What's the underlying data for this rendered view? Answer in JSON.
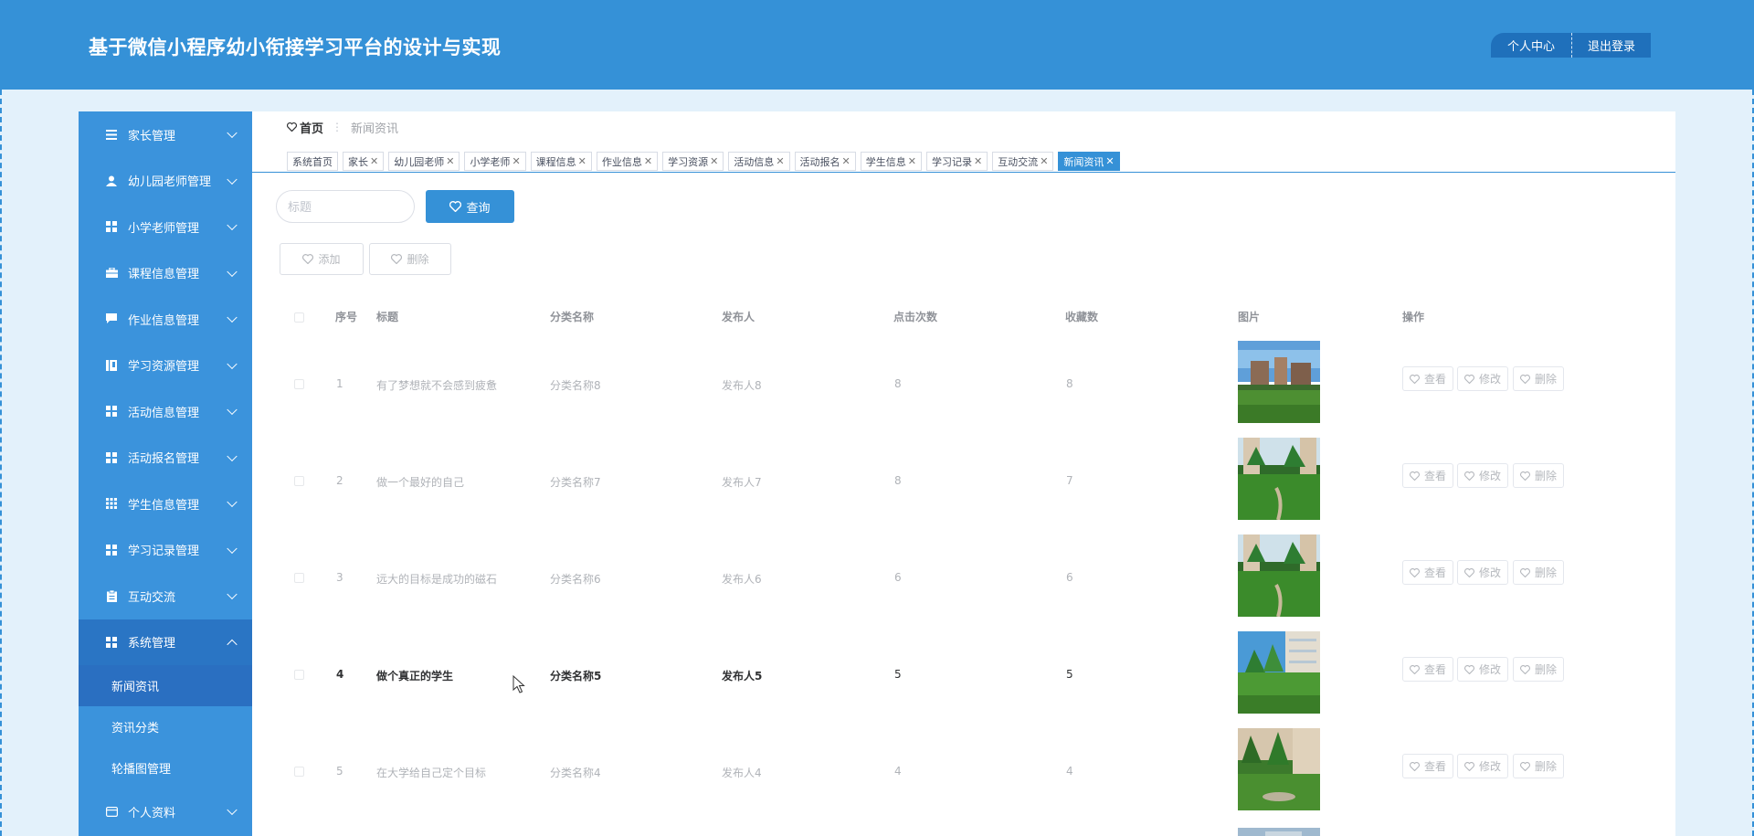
{
  "header": {
    "title": "基于微信小程序幼小衔接学习平台的设计与实现",
    "personal_center": "个人中心",
    "logout": "退出登录"
  },
  "sidebar": {
    "items": [
      {
        "label": "家长管理",
        "icon": "list-icon"
      },
      {
        "label": "幼儿园老师管理",
        "icon": "user-icon"
      },
      {
        "label": "小学老师管理",
        "icon": "grid-icon"
      },
      {
        "label": "课程信息管理",
        "icon": "briefcase-icon"
      },
      {
        "label": "作业信息管理",
        "icon": "chat-icon"
      },
      {
        "label": "学习资源管理",
        "icon": "book-icon"
      },
      {
        "label": "活动信息管理",
        "icon": "grid-icon"
      },
      {
        "label": "活动报名管理",
        "icon": "grid-icon"
      },
      {
        "label": "学生信息管理",
        "icon": "grid-icon"
      },
      {
        "label": "学习记录管理",
        "icon": "grid-icon"
      },
      {
        "label": "互动交流",
        "icon": "clipboard-icon"
      },
      {
        "label": "系统管理",
        "icon": "grid-icon"
      }
    ],
    "system_sub": [
      "新闻资讯",
      "资讯分类",
      "轮播图管理"
    ],
    "profile": "个人资料"
  },
  "breadcrumb": {
    "home": "首页",
    "current": "新闻资讯"
  },
  "tags": [
    "系统首页",
    "家长",
    "幼儿园老师",
    "小学老师",
    "课程信息",
    "作业信息",
    "学习资源",
    "活动信息",
    "活动报名",
    "学生信息",
    "学习记录",
    "互动交流",
    "新闻资讯"
  ],
  "search": {
    "placeholder": "标题",
    "button": "查询"
  },
  "actions": {
    "add": "添加",
    "delete": "删除"
  },
  "table": {
    "headers": [
      "序号",
      "标题",
      "分类名称",
      "发布人",
      "点击次数",
      "收藏数",
      "图片",
      "操作"
    ],
    "row_buttons": {
      "view": "查看",
      "edit": "修改",
      "delete": "删除"
    },
    "rows": [
      {
        "seq": "1",
        "title": "有了梦想就不会感到疲惫",
        "category": "分类名称8",
        "publisher": "发布人8",
        "clicks": "8",
        "favorites": "8"
      },
      {
        "seq": "2",
        "title": "做一个最好的自己",
        "category": "分类名称7",
        "publisher": "发布人7",
        "clicks": "8",
        "favorites": "7"
      },
      {
        "seq": "3",
        "title": "远大的目标是成功的磁石",
        "category": "分类名称6",
        "publisher": "发布人6",
        "clicks": "6",
        "favorites": "6"
      },
      {
        "seq": "4",
        "title": "做个真正的学生",
        "category": "分类名称5",
        "publisher": "发布人5",
        "clicks": "5",
        "favorites": "5"
      },
      {
        "seq": "5",
        "title": "在大学给自己定个目标",
        "category": "分类名称4",
        "publisher": "发布人4",
        "clicks": "4",
        "favorites": "4"
      }
    ]
  },
  "colors": {
    "primary": "#3591d7",
    "sidebar": "#3b93dc",
    "sidebar_active": "#2a6fc1",
    "page_bg": "#e3f1fb"
  }
}
